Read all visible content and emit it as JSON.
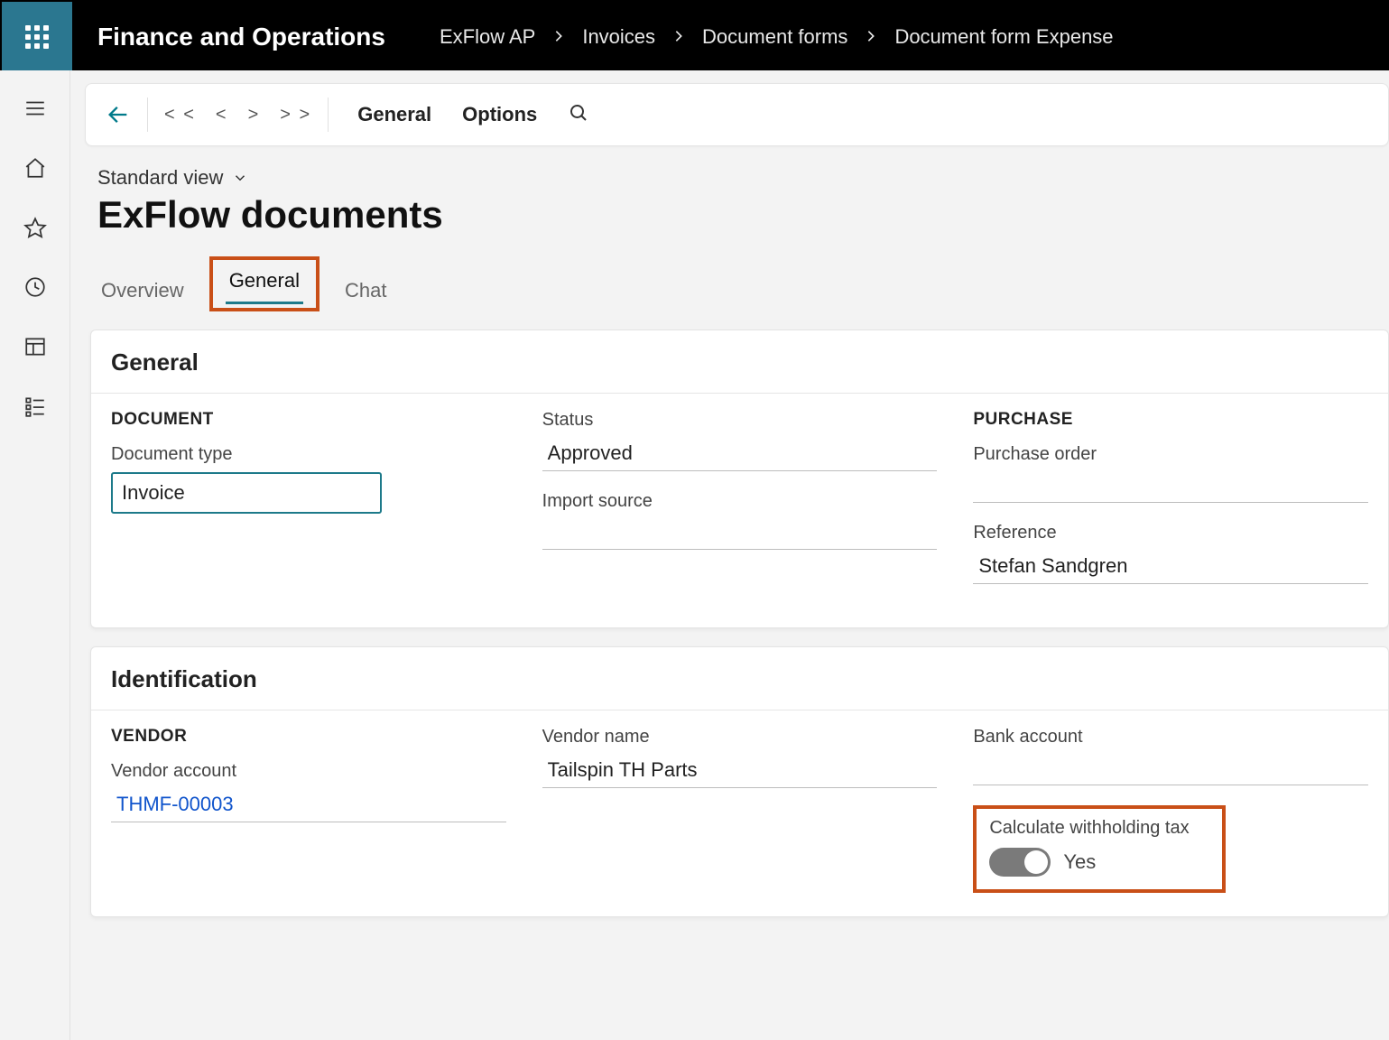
{
  "header": {
    "brand": "Finance and Operations",
    "breadcrumbs": [
      "ExFlow AP",
      "Invoices",
      "Document forms",
      "Document form Expense"
    ]
  },
  "actionbar": {
    "pager": {
      "first": "< <",
      "prev": "<",
      "next": ">",
      "last": "> >"
    },
    "tabs": {
      "general": "General",
      "options": "Options"
    }
  },
  "view": {
    "label": "Standard view"
  },
  "page": {
    "title": "ExFlow documents"
  },
  "tabs": {
    "overview": "Overview",
    "general": "General",
    "chat": "Chat",
    "active": "general"
  },
  "general_card": {
    "title": "General",
    "document": {
      "group": "DOCUMENT",
      "document_type_label": "Document type",
      "document_type_value": "Invoice"
    },
    "status": {
      "status_label": "Status",
      "status_value": "Approved",
      "import_source_label": "Import source",
      "import_source_value": ""
    },
    "purchase": {
      "group": "PURCHASE",
      "purchase_order_label": "Purchase order",
      "purchase_order_value": "",
      "reference_label": "Reference",
      "reference_value": "Stefan Sandgren"
    }
  },
  "identification_card": {
    "title": "Identification",
    "vendor": {
      "group": "VENDOR",
      "vendor_account_label": "Vendor account",
      "vendor_account_value": "THMF-00003"
    },
    "middle": {
      "vendor_name_label": "Vendor name",
      "vendor_name_value": "Tailspin TH Parts"
    },
    "right": {
      "bank_account_label": "Bank account",
      "bank_account_value": "",
      "withholding_label": "Calculate withholding tax",
      "withholding_value": "Yes",
      "withholding_on": true
    }
  }
}
